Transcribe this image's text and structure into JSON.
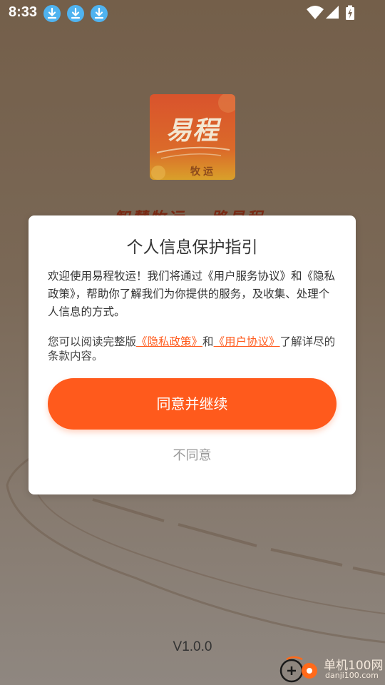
{
  "status_bar": {
    "time": "8:33",
    "notification_icons": [
      "download-icon",
      "download-icon",
      "download-icon"
    ],
    "system_icons": [
      "wifi-icon",
      "signal-icon",
      "battery-charging-icon"
    ]
  },
  "splash": {
    "logo_main": "易程",
    "logo_sub": "牧运",
    "slogan": "智慧牧运 一路易程",
    "version": "V1.0.0",
    "colors": {
      "logo_top": "#e0502a",
      "logo_bottom": "#e0a020"
    }
  },
  "dialog": {
    "title": "个人信息保护指引",
    "body": "欢迎使用易程牧运！我们将通过《用户服务协议》和《隐私政策》，帮助你了解我们为你提供的服务，及收集、处理个人信息的方式。",
    "detail_prefix": "您可以阅读完整版",
    "privacy_link": "《隐私政策》",
    "detail_and": "和",
    "user_agreement_link": "《用户协议》",
    "detail_suffix": "了解详尽的条款内容。",
    "agree_label": "同意并继续",
    "disagree_label": "不同意",
    "colors": {
      "accent": "#ff5a1c",
      "muted": "#999999"
    }
  },
  "watermark": {
    "title": "单机100网",
    "url": "danji100.com"
  }
}
